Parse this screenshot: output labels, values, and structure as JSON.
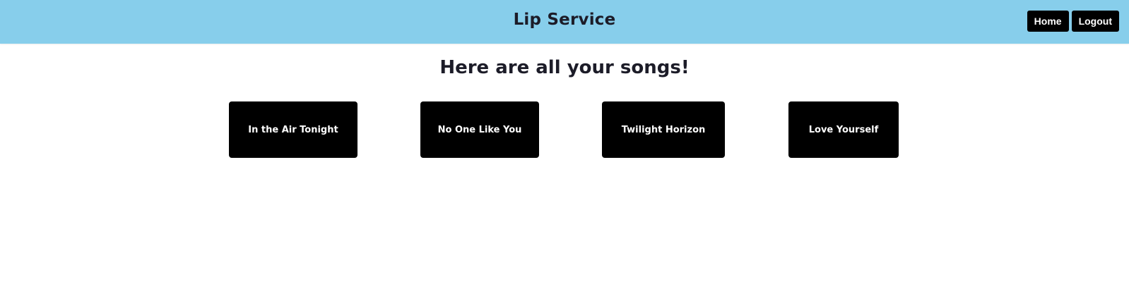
{
  "header": {
    "title": "Lip Service",
    "nav": {
      "home_label": "Home",
      "logout_label": "Logout"
    }
  },
  "main": {
    "heading": "Here are all your songs!",
    "songs": [
      {
        "title": "In the Air Tonight"
      },
      {
        "title": "No One Like You"
      },
      {
        "title": "Twilight Horizon"
      },
      {
        "title": "Love Yourself"
      }
    ]
  },
  "colors": {
    "navbar_bg": "#87ceeb",
    "button_bg": "#000000",
    "button_text": "#ffffff",
    "heading_text": "#1c1c28"
  }
}
